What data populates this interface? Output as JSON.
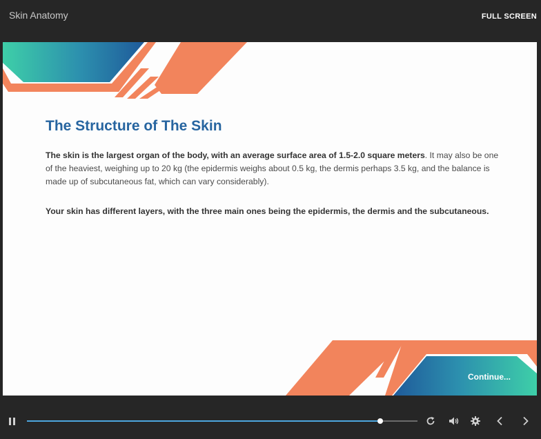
{
  "header": {
    "title": "Skin Anatomy",
    "fullscreen_label": "FULL SCREEN"
  },
  "slide": {
    "title": "The Structure of The Skin",
    "para1_bold": "The skin is the largest organ of the body, with an average surface area of 1.5-2.0 square meters",
    "para1_rest": ". It may also be one of the heaviest, weighing up to 20 kg (the epidermis weighs about 0.5 kg, the dermis perhaps 3.5 kg, and the balance is made up of subcutaneous fat, which can vary considerably).",
    "para2": "Your skin has different layers, with the three main ones being the epidermis, the dermis and the subcutaneous.",
    "continue_label": "Continue..."
  },
  "player": {
    "progress": 0.905,
    "icons": [
      "pause-icon",
      "replay-icon",
      "volume-icon",
      "settings-icon",
      "prev-icon",
      "next-icon"
    ]
  },
  "colors": {
    "accent_orange": "#f2845c",
    "title_blue": "#2765a0",
    "progress_blue": "#4da7e0",
    "teal": "#3ecfa8",
    "navy": "#1f5a9a"
  }
}
